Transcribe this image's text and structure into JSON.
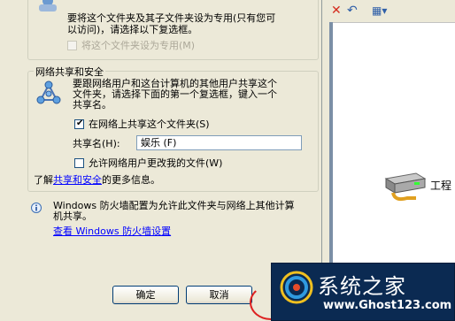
{
  "local_section": {
    "text": "要将这个文件夹及其子文件夹设为专用(只有您可以访问)，请选择以下复选框。",
    "line1": "要将这个文件夹及其子文件夹设为专用(只有您可",
    "line2": "以访问)，请选择以下复选框。",
    "make_private_label": "将这个文件夹设为专用(M)"
  },
  "network_section": {
    "title": "网络共享和安全",
    "line1": "要跟网络用户和这台计算机的其他用户共享这个",
    "line2": "文件夹，请选择下面的第一个复选框，键入一个",
    "line3": "共享名。",
    "share_checkbox_label": "在网络上共享这个文件夹(S)",
    "share_checked": true,
    "share_name_label": "共享名(H):",
    "share_name_value": "娱乐 (F)",
    "allow_change_label": "允许网络用户更改我的文件(W)",
    "allow_change_checked": false,
    "learn_more_prefix": "了解",
    "learn_more_link": "共享和安全",
    "learn_more_suffix": "的更多信息。"
  },
  "firewall": {
    "line1": "Windows 防火墙配置为允许此文件夹与网络上其他计算",
    "line2": "机共享。",
    "link": "查看 Windows 防火墙设置"
  },
  "buttons": {
    "ok": "确定",
    "cancel": "取消"
  },
  "explorer": {
    "drive_label": "工程"
  },
  "watermark": {
    "title": "系统之家",
    "url": "www.Ghost123.com"
  },
  "colors": {
    "dialog_bg": "#ece9d8",
    "link": "#0000ff",
    "watermark_bg": "#0b2a52"
  }
}
